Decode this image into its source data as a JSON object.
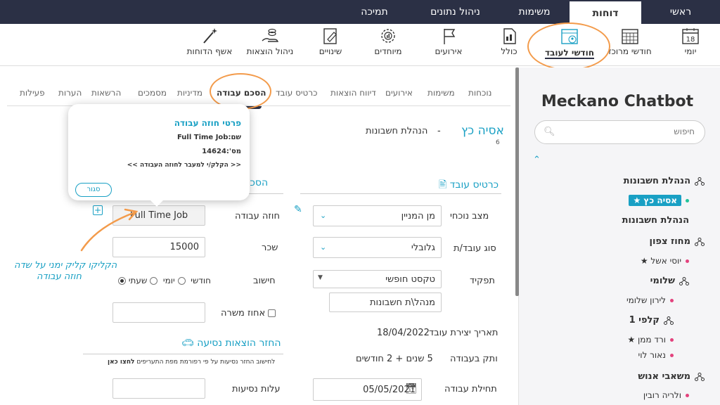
{
  "top_tabs": [
    "ראשי",
    "דוחות",
    "משימות",
    "ניהול נתונים",
    "תמיכה"
  ],
  "ribbon": [
    {
      "label": "יומי",
      "icon": "calendar-18-icon",
      "day": "18"
    },
    {
      "label": "חודשי מרוכז",
      "icon": "calendar-grid-icon"
    },
    {
      "label": "חודשי לעובד",
      "icon": "calendar-employee-icon"
    },
    {
      "label": "כולל",
      "icon": "document-chart-icon"
    },
    {
      "label": "אירועים",
      "icon": "flag-icon"
    },
    {
      "label": "מיוחדים",
      "icon": "gear-chart-icon"
    },
    {
      "label": "שינויים",
      "icon": "edit-report-icon"
    },
    {
      "label": "ניהול הוצאות",
      "icon": "hand-coins-icon"
    },
    {
      "label": "אשף הדוחות",
      "icon": "magic-wand-icon"
    }
  ],
  "sidebar": {
    "title": "Meckano Chatbot",
    "search_placeholder": "חיפוש",
    "items": [
      {
        "text": "הנהלת חשבונות",
        "kind": "group"
      },
      {
        "text": "אסיה כץ ★",
        "kind": "selected"
      },
      {
        "text": "הנהלת חשבונות",
        "kind": "subgroup"
      },
      {
        "text": "מחוז צפון",
        "kind": "group"
      },
      {
        "text": "יוסי אשל ★",
        "kind": "person"
      },
      {
        "text": "שלומי",
        "kind": "group"
      },
      {
        "text": "לירון שלומי",
        "kind": "person"
      },
      {
        "text": "קלפי 1",
        "kind": "group"
      },
      {
        "text": "ורד ממן ★",
        "kind": "person"
      },
      {
        "text": "נאור לוי",
        "kind": "person"
      },
      {
        "text": "משאבי אנוש",
        "kind": "group"
      },
      {
        "text": "ולריה רובין",
        "kind": "person"
      }
    ]
  },
  "sub_tabs": [
    "נוכחות",
    "משימות",
    "אירועים",
    "דיווח הוצאות",
    "כרטיס עובד",
    "הסכם עבודה",
    "מדיניות",
    "מסמכים",
    "הרשאות",
    "הערות",
    "פעילות"
  ],
  "employee": {
    "name": "אסיה כץ",
    "id": "6",
    "separator": "-",
    "department": "הנהלת חשבונות"
  },
  "card": {
    "title": "כרטיס עובד",
    "status_label": "מצב נוכחי",
    "status_value": "מן המניין",
    "type_label": "סוג עובד/ת",
    "type_value": "גלובלי",
    "role_label": "תפקיד",
    "role_select": "טקסט חופשי",
    "role_value": "מנהל\\ת חשבונות",
    "created_label": "תאריך יצירת עובד",
    "created_value": "18/04/2022",
    "tenure_label": "ותק בעבודה",
    "tenure_value": "5 שנים + 2 חודשים",
    "start_label": "תחילת עבודה",
    "start_value": "05/05/2021"
  },
  "agreement": {
    "title": "הסכם",
    "contract_label": "חוזה עבודה",
    "contract_value": "Full Time Job",
    "salary_label": "שכר",
    "salary_value": "15000",
    "calc_label": "חישוב",
    "calc_options": [
      "חודשי",
      "יומי",
      "שעתי"
    ],
    "calc_selected": "חודשי",
    "percent_label": "אחוז משרה",
    "travel_title": "החזר הוצאות נסיעה",
    "travel_note": "לחישוב החזר נסיעות על פי רפורמת מפת התעריפים",
    "travel_link": "לחצו כאן",
    "travel_cost_label": "עלות נסיעות"
  },
  "popup": {
    "title": "פרטי חוזה עבודה",
    "name_line": "שם:Full Time Job",
    "number_line": "מס':14624",
    "link_line": "<< הקלק/י למעבר לחוזה העבודה >>",
    "close_label": "סגור"
  },
  "annotation": {
    "line1": "הקליקו קליק ימני על שדה",
    "line2": "חוזה עבודה"
  },
  "colors": {
    "accent": "#19a0c4",
    "topbar": "#2b3045",
    "highlight": "#f39b4b",
    "dot": "#e3427d",
    "dot_selected": "#22c39a"
  }
}
